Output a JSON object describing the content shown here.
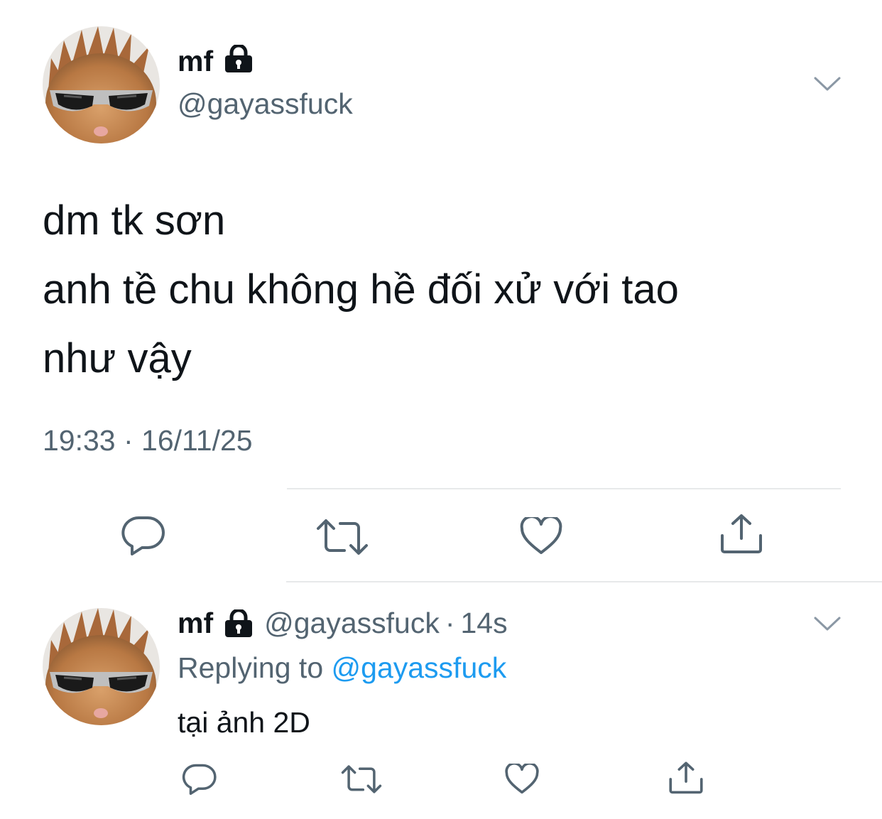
{
  "main_tweet": {
    "display_name": "mf",
    "handle": "@gayassfuck",
    "text_lines": [
      "dm tk sơn",
      "anh tề chu không hề đối xử với tao",
      "như vậy"
    ],
    "timestamp": "19:33 · 16/11/25",
    "icons": [
      "lock-icon",
      "chevron-down-icon",
      "reply-icon",
      "retweet-icon",
      "like-icon",
      "share-icon"
    ]
  },
  "reply_tweet": {
    "display_name": "mf",
    "handle": "@gayassfuck",
    "separator": "·",
    "time_ago": "14s",
    "replying_prefix": "Replying to",
    "replying_to": "@gayassfuck",
    "text": "tại ảnh 2D"
  },
  "colors": {
    "text_primary": "#0f1419",
    "text_secondary": "#536471",
    "accent": "#1d9bf0",
    "icon": "#536471",
    "divider": "#e7e9ea"
  }
}
